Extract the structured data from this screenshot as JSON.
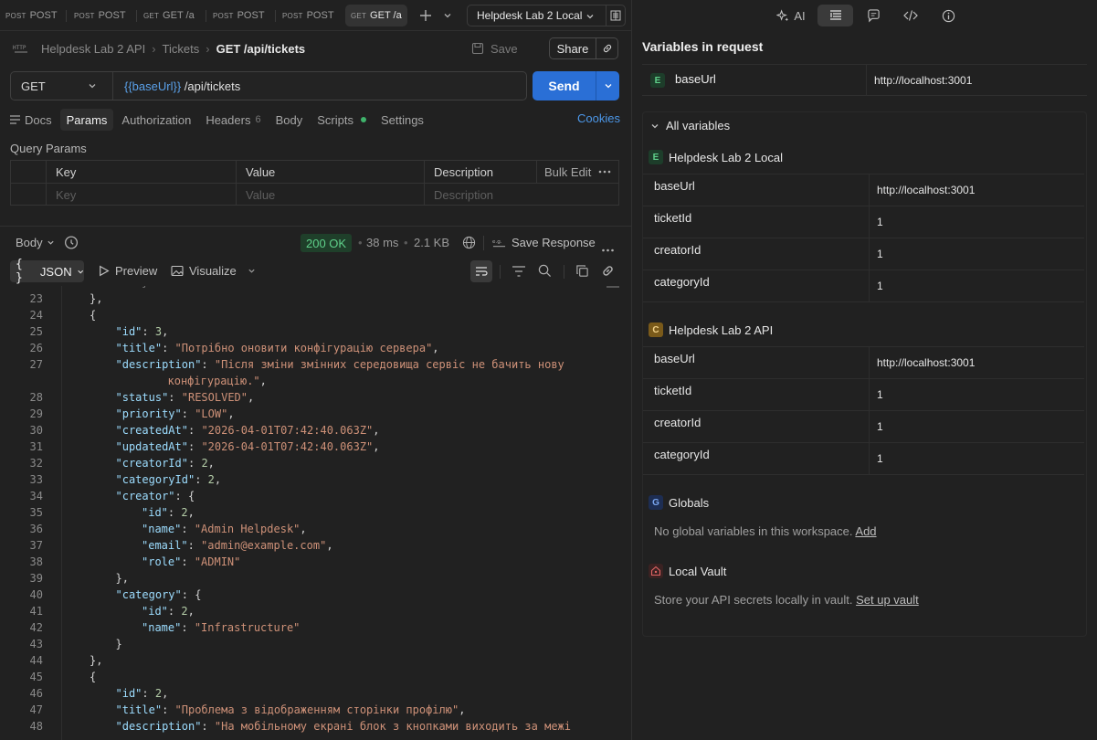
{
  "tabs": [
    {
      "method": "POST",
      "label": "POST"
    },
    {
      "method": "POST",
      "label": "POST"
    },
    {
      "method": "GET",
      "label": "GET /a"
    },
    {
      "method": "POST",
      "label": "POST"
    },
    {
      "method": "POST",
      "label": "POST"
    },
    {
      "method": "GET",
      "label": "GET /a"
    }
  ],
  "environment": {
    "selected": "Helpdesk Lab 2 Local"
  },
  "breadcrumb": {
    "collection": "Helpdesk Lab 2 API",
    "folder": "Tickets",
    "current": "GET /api/tickets"
  },
  "toolbar": {
    "save_label": "Save",
    "share_label": "Share"
  },
  "request": {
    "method": "GET",
    "url_var": "{{baseUrl}}",
    "url_path": " /api/tickets",
    "send_label": "Send"
  },
  "request_tabs": {
    "docs": "Docs",
    "params": "Params",
    "authorization": "Authorization",
    "headers": "Headers",
    "headers_count": "6",
    "body": "Body",
    "scripts": "Scripts",
    "settings": "Settings",
    "cookies": "Cookies"
  },
  "query_params": {
    "title": "Query Params",
    "headers": {
      "key": "Key",
      "value": "Value",
      "description": "Description",
      "bulk_edit": "Bulk Edit"
    },
    "placeholders": {
      "key": "Key",
      "value": "Value",
      "description": "Description"
    }
  },
  "response": {
    "body_label": "Body",
    "status": "200 OK",
    "time": "38 ms",
    "size": "2.1 KB",
    "save_response": "Save Response",
    "format": "JSON",
    "preview": "Preview",
    "visualize": "Visualize"
  },
  "code_lines": [
    {
      "n": "23",
      "indent": 1,
      "t": [
        [
          "p",
          "},"
        ]
      ]
    },
    {
      "n": "24",
      "indent": 1,
      "t": [
        [
          "p",
          "{"
        ]
      ]
    },
    {
      "n": "25",
      "indent": 2,
      "t": [
        [
          "k",
          "\"id\""
        ],
        [
          "p",
          ": "
        ],
        [
          "n",
          "3"
        ],
        [
          "p",
          ","
        ]
      ]
    },
    {
      "n": "26",
      "indent": 2,
      "t": [
        [
          "k",
          "\"title\""
        ],
        [
          "p",
          ": "
        ],
        [
          "s",
          "\"Потрібно оновити конфігурацію сервера\""
        ],
        [
          "p",
          ","
        ]
      ]
    },
    {
      "n": "27",
      "indent": 2,
      "t": [
        [
          "k",
          "\"description\""
        ],
        [
          "p",
          ": "
        ],
        [
          "s",
          "\"Після зміни змінних середовища сервіс не бачить нову"
        ]
      ]
    },
    {
      "n": "",
      "indent": 4,
      "t": [
        [
          "s",
          "конфігурацію.\""
        ],
        [
          "p",
          ","
        ]
      ]
    },
    {
      "n": "28",
      "indent": 2,
      "t": [
        [
          "k",
          "\"status\""
        ],
        [
          "p",
          ": "
        ],
        [
          "s",
          "\"RESOLVED\""
        ],
        [
          "p",
          ","
        ]
      ]
    },
    {
      "n": "29",
      "indent": 2,
      "t": [
        [
          "k",
          "\"priority\""
        ],
        [
          "p",
          ": "
        ],
        [
          "s",
          "\"LOW\""
        ],
        [
          "p",
          ","
        ]
      ]
    },
    {
      "n": "30",
      "indent": 2,
      "t": [
        [
          "k",
          "\"createdAt\""
        ],
        [
          "p",
          ": "
        ],
        [
          "s",
          "\"2026-04-01T07:42:40.063Z\""
        ],
        [
          "p",
          ","
        ]
      ]
    },
    {
      "n": "31",
      "indent": 2,
      "t": [
        [
          "k",
          "\"updatedAt\""
        ],
        [
          "p",
          ": "
        ],
        [
          "s",
          "\"2026-04-01T07:42:40.063Z\""
        ],
        [
          "p",
          ","
        ]
      ]
    },
    {
      "n": "32",
      "indent": 2,
      "t": [
        [
          "k",
          "\"creatorId\""
        ],
        [
          "p",
          ": "
        ],
        [
          "n",
          "2"
        ],
        [
          "p",
          ","
        ]
      ]
    },
    {
      "n": "33",
      "indent": 2,
      "t": [
        [
          "k",
          "\"categoryId\""
        ],
        [
          "p",
          ": "
        ],
        [
          "n",
          "2"
        ],
        [
          "p",
          ","
        ]
      ]
    },
    {
      "n": "34",
      "indent": 2,
      "t": [
        [
          "k",
          "\"creator\""
        ],
        [
          "p",
          ": {"
        ]
      ]
    },
    {
      "n": "35",
      "indent": 3,
      "t": [
        [
          "k",
          "\"id\""
        ],
        [
          "p",
          ": "
        ],
        [
          "n",
          "2"
        ],
        [
          "p",
          ","
        ]
      ]
    },
    {
      "n": "36",
      "indent": 3,
      "t": [
        [
          "k",
          "\"name\""
        ],
        [
          "p",
          ": "
        ],
        [
          "s",
          "\"Admin Helpdesk\""
        ],
        [
          "p",
          ","
        ]
      ]
    },
    {
      "n": "37",
      "indent": 3,
      "t": [
        [
          "k",
          "\"email\""
        ],
        [
          "p",
          ": "
        ],
        [
          "s",
          "\"admin@example.com\""
        ],
        [
          "p",
          ","
        ]
      ]
    },
    {
      "n": "38",
      "indent": 3,
      "t": [
        [
          "k",
          "\"role\""
        ],
        [
          "p",
          ": "
        ],
        [
          "s",
          "\"ADMIN\""
        ]
      ]
    },
    {
      "n": "39",
      "indent": 2,
      "t": [
        [
          "p",
          "},"
        ]
      ]
    },
    {
      "n": "40",
      "indent": 2,
      "t": [
        [
          "k",
          "\"category\""
        ],
        [
          "p",
          ": {"
        ]
      ]
    },
    {
      "n": "41",
      "indent": 3,
      "t": [
        [
          "k",
          "\"id\""
        ],
        [
          "p",
          ": "
        ],
        [
          "n",
          "2"
        ],
        [
          "p",
          ","
        ]
      ]
    },
    {
      "n": "42",
      "indent": 3,
      "t": [
        [
          "k",
          "\"name\""
        ],
        [
          "p",
          ": "
        ],
        [
          "s",
          "\"Infrastructure\""
        ]
      ]
    },
    {
      "n": "43",
      "indent": 2,
      "t": [
        [
          "p",
          "}"
        ]
      ]
    },
    {
      "n": "44",
      "indent": 1,
      "t": [
        [
          "p",
          "},"
        ]
      ]
    },
    {
      "n": "45",
      "indent": 1,
      "t": [
        [
          "p",
          "{"
        ]
      ]
    },
    {
      "n": "46",
      "indent": 2,
      "t": [
        [
          "k",
          "\"id\""
        ],
        [
          "p",
          ": "
        ],
        [
          "n",
          "2"
        ],
        [
          "p",
          ","
        ]
      ]
    },
    {
      "n": "47",
      "indent": 2,
      "t": [
        [
          "k",
          "\"title\""
        ],
        [
          "p",
          ": "
        ],
        [
          "s",
          "\"Проблема з відображенням сторінки профілю\""
        ],
        [
          "p",
          ","
        ]
      ]
    },
    {
      "n": "48",
      "indent": 2,
      "t": [
        [
          "k",
          "\"description\""
        ],
        [
          "p",
          ": "
        ],
        [
          "s",
          "\"На мобільному екрані блок з кнопками виходить за межі"
        ]
      ]
    }
  ],
  "right_panel": {
    "tools": {
      "ai": "AI"
    },
    "title": "Variables in request",
    "request_var": {
      "badge": "E",
      "name": "baseUrl",
      "value": "http://localhost:3001"
    },
    "all_variables": "All variables",
    "sections": [
      {
        "badge": "E",
        "name": "Helpdesk Lab 2 Local",
        "vars": [
          {
            "key": "baseUrl",
            "value": "http://localhost:3001"
          },
          {
            "key": "ticketId",
            "value": "1"
          },
          {
            "key": "creatorId",
            "value": "1"
          },
          {
            "key": "categoryId",
            "value": "1"
          }
        ]
      },
      {
        "badge": "C",
        "name": "Helpdesk Lab 2 API",
        "vars": [
          {
            "key": "baseUrl",
            "value": "http://localhost:3001"
          },
          {
            "key": "ticketId",
            "value": "1"
          },
          {
            "key": "creatorId",
            "value": "1"
          },
          {
            "key": "categoryId",
            "value": "1"
          }
        ]
      }
    ],
    "globals": {
      "badge": "G",
      "name": "Globals",
      "text": "No global variables in this workspace.",
      "link": "Add"
    },
    "vault": {
      "name": "Local Vault",
      "text": "Store your API secrets locally in vault.",
      "link": "Set up vault"
    }
  },
  "colors": {
    "accent": "#2a6fd6",
    "status_ok": "#5fd08a",
    "json_key": "#9cdcfe",
    "json_string": "#ce9178",
    "json_number": "#b5cea8"
  }
}
